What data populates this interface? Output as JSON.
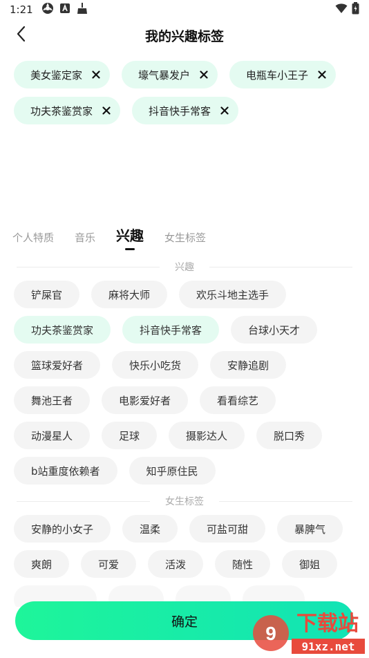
{
  "status_bar": {
    "time": "1:21"
  },
  "header": {
    "title": "我的兴趣标签"
  },
  "selected_tags": [
    "美女鉴定家",
    "壕气暴发户",
    "电瓶车小王子",
    "功夫茶鉴赏家",
    "抖音快手常客"
  ],
  "tabs": [
    {
      "label": "个人特质",
      "active": false
    },
    {
      "label": "音乐",
      "active": false
    },
    {
      "label": "兴趣",
      "active": true
    },
    {
      "label": "女生标签",
      "active": false
    }
  ],
  "sections": [
    {
      "title": "兴趣",
      "tags": [
        {
          "label": "铲屎官",
          "selected": false
        },
        {
          "label": "麻将大师",
          "selected": false
        },
        {
          "label": "欢乐斗地主选手",
          "selected": false
        },
        {
          "label": "功夫茶鉴赏家",
          "selected": true
        },
        {
          "label": "抖音快手常客",
          "selected": true
        },
        {
          "label": "台球小天才",
          "selected": false
        },
        {
          "label": "篮球爱好者",
          "selected": false
        },
        {
          "label": "快乐小吃货",
          "selected": false
        },
        {
          "label": "安静追剧",
          "selected": false
        },
        {
          "label": "舞池王者",
          "selected": false
        },
        {
          "label": "电影爱好者",
          "selected": false
        },
        {
          "label": "看看综艺",
          "selected": false
        },
        {
          "label": "动漫星人",
          "selected": false
        },
        {
          "label": "足球",
          "selected": false
        },
        {
          "label": "摄影达人",
          "selected": false
        },
        {
          "label": "脱口秀",
          "selected": false
        },
        {
          "label": "b站重度依赖者",
          "selected": false
        },
        {
          "label": "知乎原住民",
          "selected": false
        }
      ]
    },
    {
      "title": "女生标签",
      "tags": [
        {
          "label": "安静的小女子",
          "selected": false
        },
        {
          "label": "温柔",
          "selected": false
        },
        {
          "label": "可盐可甜",
          "selected": false
        },
        {
          "label": "暴脾气",
          "selected": false
        },
        {
          "label": "爽朗",
          "selected": false
        },
        {
          "label": "可爱",
          "selected": false
        },
        {
          "label": "活泼",
          "selected": false
        },
        {
          "label": "随性",
          "selected": false
        },
        {
          "label": "御姐",
          "selected": false
        }
      ]
    }
  ],
  "confirm_label": "确定",
  "watermark": {
    "text_top": "下载站",
    "text_bottom": "91xz.net"
  },
  "colors": {
    "accent": "#1ef59a",
    "chip_selected": "#e4fbf1",
    "chip_default": "#f4f4f4"
  }
}
